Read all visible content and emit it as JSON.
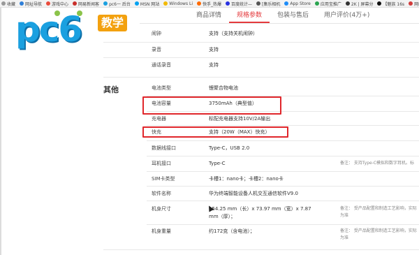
{
  "bookmarks": [
    {
      "label": "收藏",
      "color": "#999999"
    },
    {
      "label": "网址导航",
      "color": "#2f7fd8"
    },
    {
      "label": "游戏中心",
      "color": "#e94b3c"
    },
    {
      "label": "网易新闻客",
      "color": "#c9302c"
    },
    {
      "label": "pc6一 后台",
      "color": "#1aa0e0"
    },
    {
      "label": "MSN 网站",
      "color": "#00a1f1"
    },
    {
      "label": "Windows Li",
      "color": "#f2b900"
    },
    {
      "label": "快手_热爆",
      "color": "#ff6a00"
    },
    {
      "label": "百度统计—",
      "color": "#2932e1"
    },
    {
      "label": "[集乐相机",
      "color": "#555555"
    },
    {
      "label": "App Store",
      "color": "#1d8cf8"
    },
    {
      "label": "应用宝推广",
      "color": "#2aa44f"
    },
    {
      "label": "2K | 屏幕分",
      "color": "#333333"
    },
    {
      "label": "【魅族 16s",
      "color": "#111111"
    },
    {
      "label": "网络办公",
      "color": "#d23b3b"
    }
  ],
  "logo": {
    "text": "pc6",
    "badge": "教学"
  },
  "tabs": [
    {
      "label": "商品详情",
      "active": false
    },
    {
      "label": "规格参数",
      "active": true
    },
    {
      "label": "包装与售后",
      "active": false
    },
    {
      "label": "用户评价(4万+)",
      "active": false
    }
  ],
  "top_rows": [
    {
      "key": "闹钟",
      "value": "支持（支持关机闹钟）"
    },
    {
      "key": "录音",
      "value": "支持"
    },
    {
      "key": "通话录音",
      "value": "支持"
    }
  ],
  "section": {
    "title": "其他"
  },
  "rows": [
    {
      "key": "电池类型",
      "value": "锂聚合物电池",
      "note": ""
    },
    {
      "key": "电池容量",
      "value": "3750mAh（典型值）",
      "note": ""
    },
    {
      "key": "充电器",
      "value": "标配充电器支持10V/2A输出",
      "note": ""
    },
    {
      "key": "快充",
      "value": "支持（20W（MAX）快充）",
      "note": ""
    },
    {
      "key": "数据线接口",
      "value": "Type-C，USB 2.0",
      "note": ""
    },
    {
      "key": "耳机接口",
      "value": "Type-C",
      "note": "备注： 支持Type-C模拟和数字耳机。标"
    },
    {
      "key": "SIM卡类型",
      "value": "卡槽1：nano卡；卡槽2：nano卡",
      "note": ""
    },
    {
      "key": "软件名称",
      "value": "华为终端智能设备人机交互通信软件V9.0",
      "note": ""
    },
    {
      "key": "机身尺寸",
      "value": "154.25 mm（长）x 73.97 mm（宽）x 7.87 mm（厚）；",
      "note": "备注： 受产品配置和制造工艺影响，实际为准"
    },
    {
      "key": "机身重量",
      "value": "约172克（含电池）；",
      "note": "备注： 受产品配置和制造工艺影响，实际为准"
    }
  ],
  "colors": {
    "accent": "#e4393c",
    "highlight_box": "#e0262b",
    "logo_blue": "#1aa0e0",
    "badge": "#f3a10f"
  }
}
